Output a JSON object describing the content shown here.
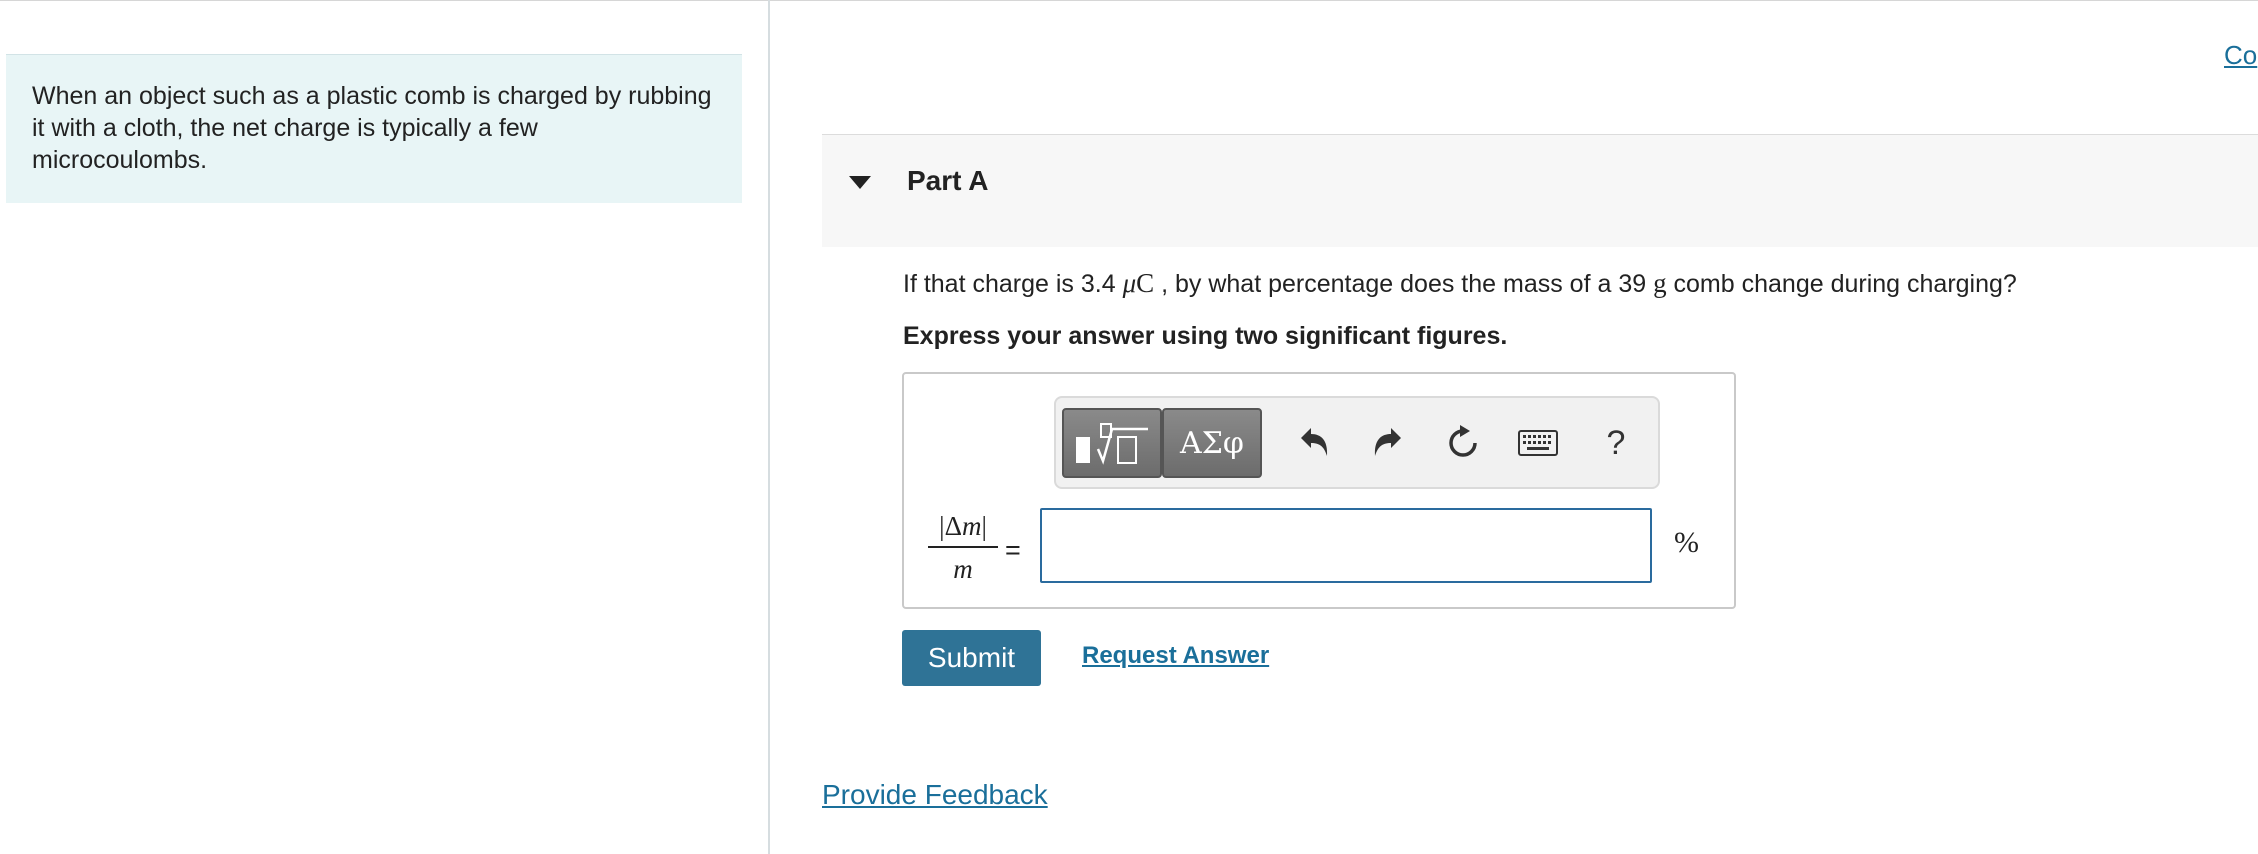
{
  "intro": {
    "text": "When an object such as a plastic comb is charged by rubbing it with a cloth, the net charge is typically a few microcoulombs."
  },
  "header": {
    "co_link": "Co"
  },
  "part": {
    "title": "Part A",
    "question": {
      "pre": "If that charge is 3.4 ",
      "charge_unit": "μC",
      "mid": " , by what percentage does the mass of a 39 ",
      "mass_unit": "g",
      "post": " comb change during charging?"
    },
    "instruction": "Express your answer using two significant figures."
  },
  "toolbar": {
    "greek_label": "ΑΣφ",
    "help_label": "?",
    "icons": [
      "templates-icon",
      "greek-letters-icon",
      "undo-icon",
      "redo-icon",
      "reset-icon",
      "keyboard-icon",
      "help-icon"
    ]
  },
  "answer": {
    "lhs_numerator_bar_left": "|",
    "lhs_numerator_delta": "Δ",
    "lhs_numerator_var": "m",
    "lhs_numerator_bar_right": "|",
    "lhs_denominator": "m",
    "equals": "=",
    "input_value": "",
    "unit": "%"
  },
  "actions": {
    "submit_label": "Submit",
    "request_answer_label": "Request Answer",
    "feedback_label": "Provide Feedback"
  },
  "colors": {
    "accent": "#2f7396",
    "link": "#1a6f9a",
    "intro_bg": "#e8f5f6"
  }
}
